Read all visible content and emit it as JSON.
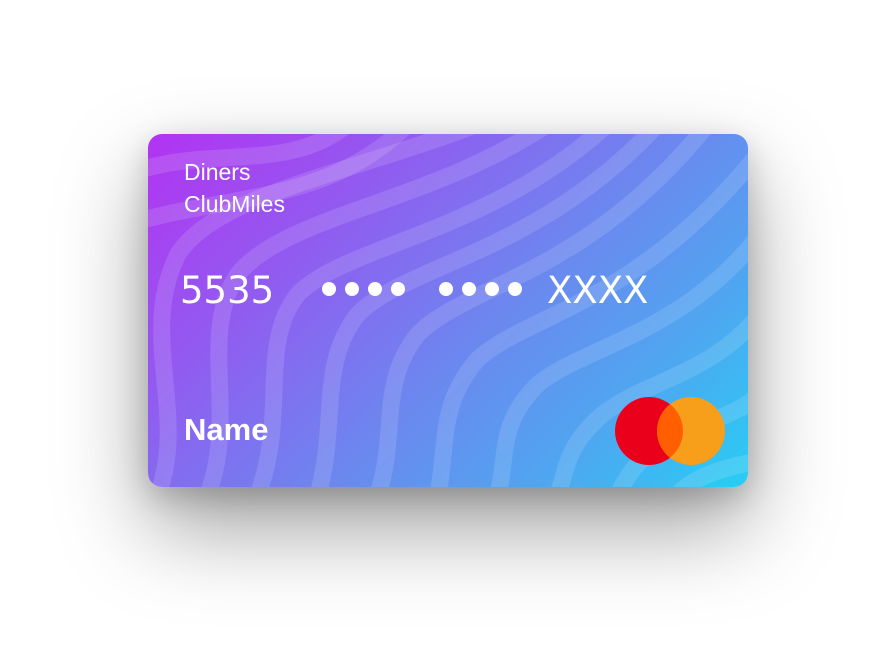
{
  "card": {
    "bank_line1": "Diners",
    "bank_line2": "ClubMiles",
    "number_first": "5535",
    "number_hidden_group": "••••",
    "number_last": "XXXX",
    "holder_name": "Name",
    "brand_icon": "mastercard-logo-icon",
    "colors": {
      "gradient_start": "#b233f2",
      "gradient_end": "#28cdf4",
      "logo_red": "#eb001b",
      "logo_orange": "#f79e1b",
      "logo_overlap": "#ff5f00"
    }
  }
}
